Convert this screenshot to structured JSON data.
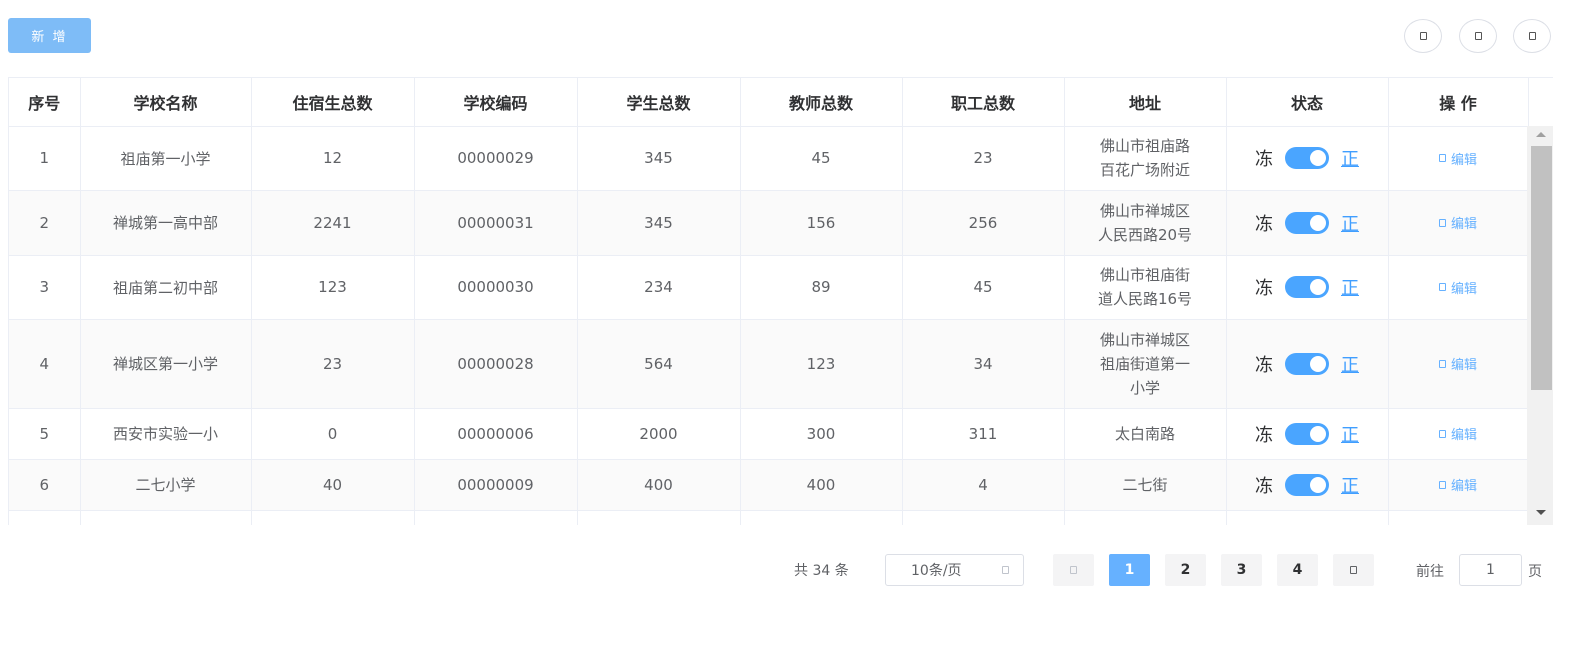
{
  "toolbar": {
    "add_label": "新 增"
  },
  "table": {
    "headers": [
      "序号",
      "学校名称",
      "住宿生总数",
      "学校编码",
      "学生总数",
      "教师总数",
      "职工总数",
      "地址",
      "状态",
      "操 作"
    ],
    "rows": [
      {
        "index": "1",
        "name": "祖庙第一小学",
        "boarders": "12",
        "code": "00000029",
        "students": "345",
        "teachers": "45",
        "staff": "23",
        "addr_lines": [
          "佛山市祖庙路",
          "百花广场附近"
        ],
        "status_left": "冻",
        "status_right": "正",
        "action": "编辑"
      },
      {
        "index": "2",
        "name": "禅城第一高中部",
        "boarders": "2241",
        "code": "00000031",
        "students": "345",
        "teachers": "156",
        "staff": "256",
        "addr_lines": [
          "佛山市禅城区",
          "人民西路20号"
        ],
        "status_left": "冻",
        "status_right": "正",
        "action": "编辑"
      },
      {
        "index": "3",
        "name": "祖庙第二初中部",
        "boarders": "123",
        "code": "00000030",
        "students": "234",
        "teachers": "89",
        "staff": "45",
        "addr_lines": [
          "佛山市祖庙街",
          "道人民路16号"
        ],
        "status_left": "冻",
        "status_right": "正",
        "action": "编辑"
      },
      {
        "index": "4",
        "name": "禅城区第一小学",
        "boarders": "23",
        "code": "00000028",
        "students": "564",
        "teachers": "123",
        "staff": "34",
        "addr_lines": [
          "佛山市禅城区",
          "祖庙街道第一",
          "小学"
        ],
        "status_left": "冻",
        "status_right": "正",
        "action": "编辑"
      },
      {
        "index": "5",
        "name": "西安市实验一小",
        "boarders": "0",
        "code": "00000006",
        "students": "2000",
        "teachers": "300",
        "staff": "311",
        "addr_lines": [
          "太白南路"
        ],
        "status_left": "冻",
        "status_right": "正",
        "action": "编辑"
      },
      {
        "index": "6",
        "name": "二七小学",
        "boarders": "40",
        "code": "00000009",
        "students": "400",
        "teachers": "400",
        "staff": "4",
        "addr_lines": [
          "二七街"
        ],
        "status_left": "冻",
        "status_right": "正",
        "action": "编辑"
      }
    ]
  },
  "pagination": {
    "total_text": "共 34 条",
    "page_size": "10条/页",
    "pages": [
      "1",
      "2",
      "3",
      "4"
    ],
    "current_page": "1",
    "goto_label": "前往",
    "goto_value": "1",
    "goto_suffix": "页"
  },
  "colors": {
    "primary": "#409eff",
    "add_button": "#7ebcf7",
    "switch_on": "#4aa5ff"
  }
}
